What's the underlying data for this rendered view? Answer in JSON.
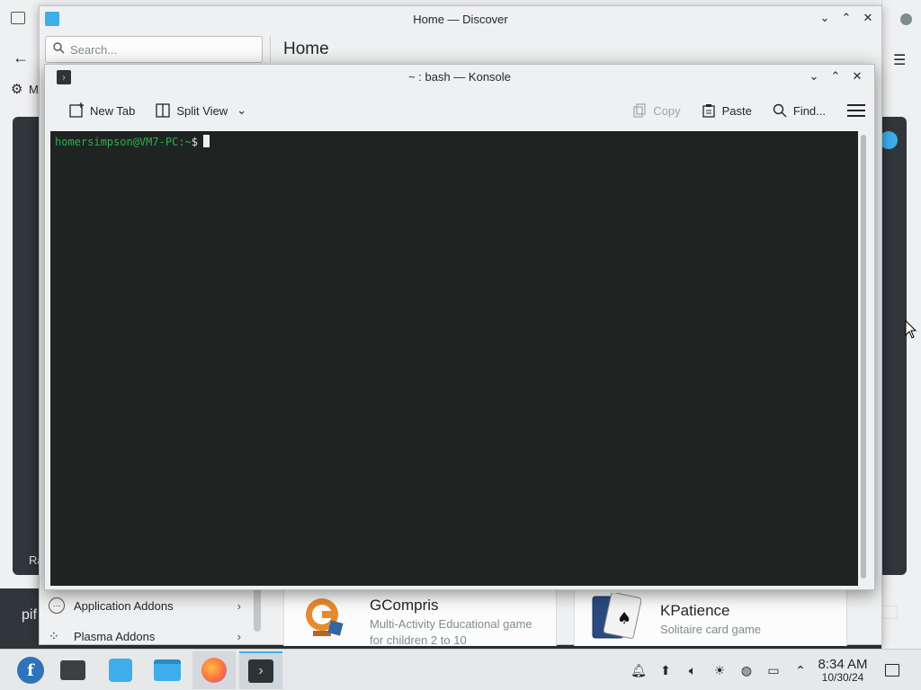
{
  "discover": {
    "title": "Home — Discover",
    "search_placeholder": "Search...",
    "heading": "Home",
    "left_partial_text": "M",
    "left_ra": "Ra",
    "left_pif": "pif",
    "sidebar": [
      {
        "label": "Application Addons",
        "icon": "addons-icon"
      },
      {
        "label": "Plasma Addons",
        "icon": "plasma-icon"
      }
    ],
    "apps": [
      {
        "name": "GCompris",
        "desc_line1": "Multi-Activity Educational game",
        "desc_line2": "for children 2 to 10"
      },
      {
        "name": "KPatience",
        "desc_line1": "Solitaire card game",
        "desc_line2": ""
      }
    ]
  },
  "konsole": {
    "title": "~ : bash — Konsole",
    "toolbar": {
      "new_tab": "New Tab",
      "split_view": "Split View",
      "copy": "Copy",
      "paste": "Paste",
      "find": "Find..."
    },
    "prompt_user": "homersimpson@VM7-PC",
    "prompt_path": ":~",
    "prompt_symbol": "$"
  },
  "taskbar": {
    "time": "8:34 AM",
    "date": "10/30/24",
    "apps": [
      "application-launcher",
      "system-settings",
      "discover",
      "dolphin-files",
      "firefox",
      "konsole"
    ],
    "active": "konsole"
  },
  "colors": {
    "accent": "#3daee9",
    "terminal_bg": "#1f2322",
    "prompt_green": "#29b34a"
  }
}
